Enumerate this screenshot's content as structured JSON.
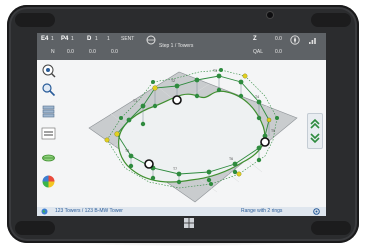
{
  "status_bar": {
    "left_label": "E4",
    "left_count": "1",
    "p_label": "P4",
    "p_count": "1",
    "d_label": "D",
    "d_value": "1",
    "mid_value": "1",
    "mode": "SENT",
    "title": "Step 1 / Towers",
    "right_label": "Z",
    "right_value": "0.0",
    "sub_left": "N",
    "sub_values": [
      "0.0",
      "0.0",
      "0.0"
    ],
    "sub_right": "QAL",
    "sub_right_value": "0.0"
  },
  "footer": {
    "left_text": "123 Towers / 123 B-MW Tower",
    "right_text": "Range with 2 rings"
  },
  "colors": {
    "accent": "#2a5d9a",
    "node_green": "#2e8b3e",
    "node_yellow": "#e0d020",
    "ring_black": "#111111"
  },
  "icons": {
    "tools": [
      "survey-tool-icon",
      "magnify-icon",
      "layers-icon",
      "xyz-coordinates-icon",
      "measure-icon",
      "color-wheel-icon"
    ],
    "right_panel": [
      "chevron-up-icon",
      "chevron-down-icon"
    ]
  }
}
